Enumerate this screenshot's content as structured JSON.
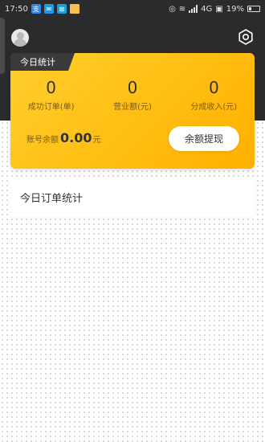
{
  "status_bar": {
    "time": "17:50",
    "network": "4G",
    "battery": "19%"
  },
  "header": {
    "avatar_icon": "user-avatar-icon",
    "settings_icon": "eye-settings-icon"
  },
  "today_card": {
    "tab_label": "今日统计",
    "stats": [
      {
        "value": "0",
        "label": "成功订单(单)"
      },
      {
        "value": "0",
        "label": "营业额(元)"
      },
      {
        "value": "0",
        "label": "分成收入(元)"
      }
    ],
    "balance_label": "账号余额",
    "balance_amount": "0.00",
    "balance_unit": "元",
    "withdraw_label": "余额提现",
    "accent_color": "#ffbe12"
  },
  "orders": {
    "title": "今日订单统计"
  }
}
